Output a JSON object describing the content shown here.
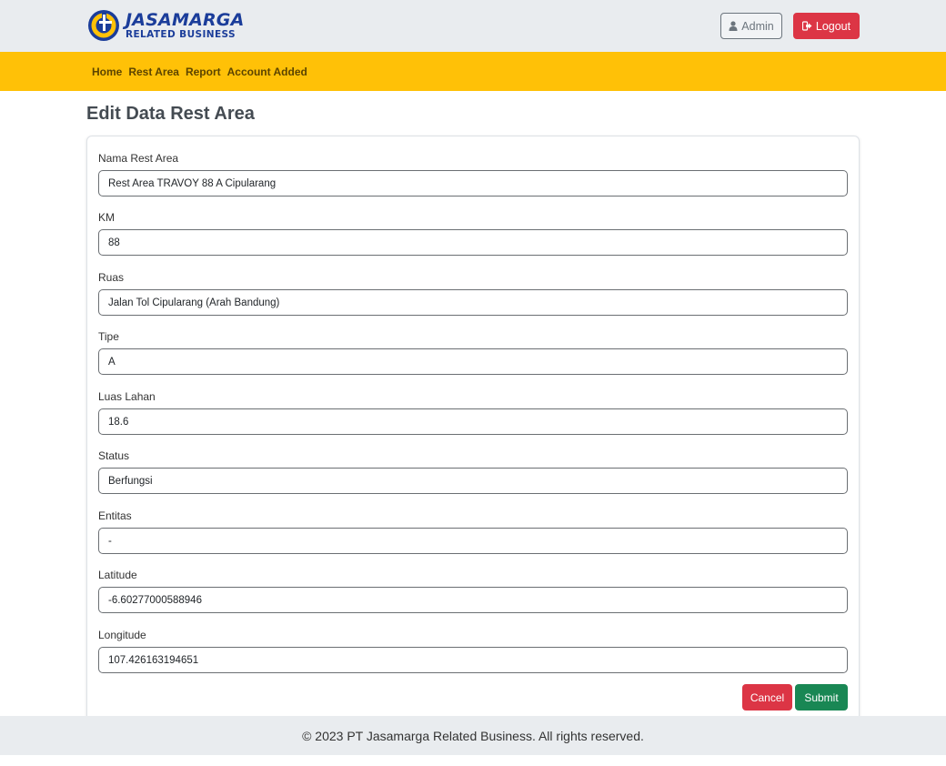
{
  "header": {
    "brand_main": "JASAMARGA",
    "brand_sub": "RELATED BUSINESS",
    "admin_label": "Admin",
    "logout_label": "Logout"
  },
  "nav": {
    "items": [
      {
        "label": "Home"
      },
      {
        "label": "Rest Area"
      },
      {
        "label": "Report"
      },
      {
        "label": "Account Added"
      }
    ]
  },
  "page": {
    "title": "Edit Data Rest Area"
  },
  "form": {
    "fields": [
      {
        "label": "Nama Rest Area",
        "value": "Rest Area TRAVOY 88 A Cipularang"
      },
      {
        "label": "KM",
        "value": "88"
      },
      {
        "label": "Ruas",
        "value": "Jalan Tol Cipularang (Arah Bandung)"
      },
      {
        "label": "Tipe",
        "value": "A"
      },
      {
        "label": "Luas Lahan",
        "value": "18.6"
      },
      {
        "label": "Status",
        "value": "Berfungsi"
      },
      {
        "label": "Entitas",
        "value": "-"
      },
      {
        "label": "Latitude",
        "value": "-6.60277000588946"
      },
      {
        "label": "Longitude",
        "value": "107.426163194651"
      }
    ],
    "cancel_label": "Cancel",
    "submit_label": "Submit"
  },
  "footer": {
    "text": "© 2023 PT Jasamarga Related Business. All rights reserved."
  },
  "colors": {
    "nav_bg": "#ffc107",
    "brand_blue": "#1b3d9a",
    "danger": "#dc3545",
    "success": "#198754",
    "topbar_bg": "#e9ecef"
  },
  "icons": {
    "admin": "user-icon",
    "logout": "sign-out-icon",
    "logo": "jasamarga-logo-icon"
  }
}
